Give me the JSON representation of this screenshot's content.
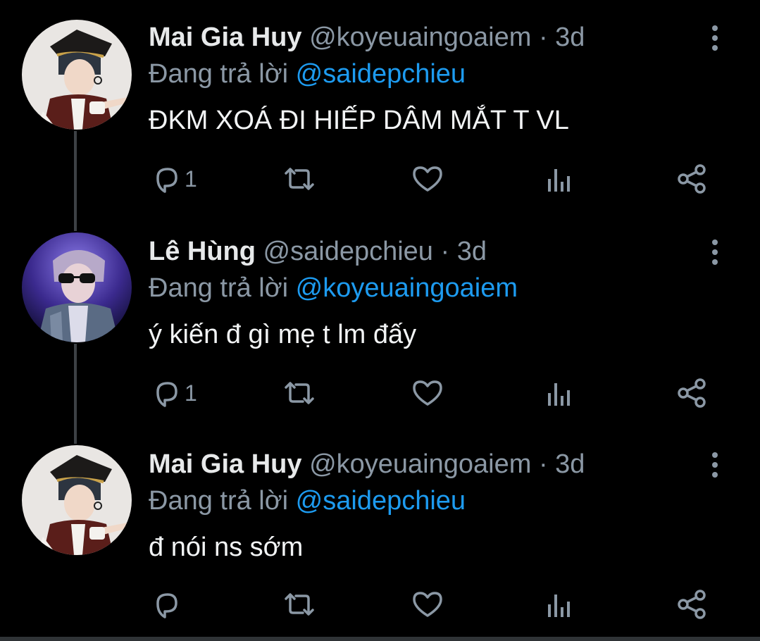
{
  "tweets": [
    {
      "name": "Mai Gia Huy",
      "handle": "@koyeuaingoaiem",
      "separator": "·",
      "time": "3d",
      "replying_prefix": "Đang trả lời",
      "replying_to": "@saidepchieu",
      "text": "ĐKM XOÁ ĐI HIẾP DÂM MẮT T VL",
      "reply_count": "1"
    },
    {
      "name": "Lê Hùng",
      "handle": "@saidepchieu",
      "separator": "·",
      "time": "3d",
      "replying_prefix": "Đang trả lời",
      "replying_to": "@koyeuaingoaiem",
      "text": "ý kiến đ gì mẹ t lm đấy",
      "reply_count": "1"
    },
    {
      "name": "Mai Gia Huy",
      "handle": "@koyeuaingoaiem",
      "separator": "·",
      "time": "3d",
      "replying_prefix": "Đang trả lời",
      "replying_to": "@saidepchieu",
      "text": "đ nói ns sớm",
      "reply_count": ""
    }
  ],
  "icons": {
    "reply": "reply-icon",
    "retweet": "retweet-icon",
    "like": "heart-icon",
    "views": "analytics-icon",
    "share": "share-icon",
    "more": "more-vertical-icon"
  },
  "colors": {
    "background": "#000000",
    "text": "#e7e9ea",
    "secondary": "#8b98a5",
    "accent": "#1d9bf0",
    "thread_line": "#3d4145"
  }
}
